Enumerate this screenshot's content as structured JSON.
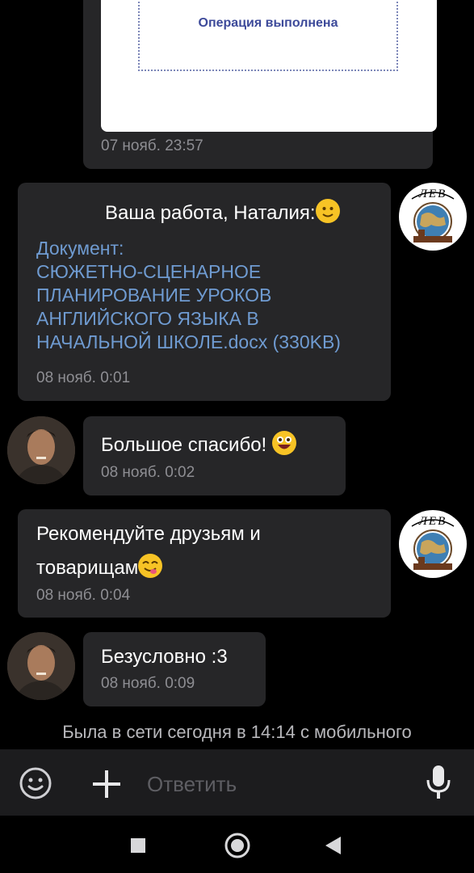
{
  "thread": {
    "receipt_card": {
      "status_text": "Операция выполнена",
      "timestamp": "07 нояб. 23:57"
    },
    "messages": [
      {
        "text": "Ваша работа, Наталия:",
        "emoji": "slight-smile-emoji",
        "attachment": "Документ:\nСЮЖЕТНО-СЦЕНАРНОЕ\nПЛАНИРОВАНИЕ УРОКОВ\nАНГЛИЙСКОГО ЯЗЫКА В\nНАЧАЛЬНОЙ ШКОЛЕ.docx (330KB)",
        "timestamp": "08 нояб. 0:01"
      },
      {
        "text": "Большое спасибо!",
        "emoji": "grinning-emoji",
        "timestamp": "08 нояб. 0:02"
      },
      {
        "text": "Рекомендуйте друзьям и товарищам",
        "line1": "Рекомендуйте друзьям и",
        "line2": "товарищам",
        "emoji": "yum-emoji",
        "timestamp": "08 нояб. 0:04"
      },
      {
        "text": "Безусловно :3",
        "timestamp": "08 нояб. 0:09"
      }
    ],
    "bot_avatar_label": "ЛЕВ",
    "status_line": "Была в сети сегодня в 14:14 с мобильного"
  },
  "composer": {
    "placeholder": "Ответить",
    "icons": [
      "emoji-icon",
      "plus-icon",
      "microphone-icon"
    ]
  },
  "navbar": {
    "icons": [
      "recent-apps-icon",
      "home-icon",
      "back-icon"
    ]
  },
  "colors": {
    "background": "#000000",
    "bubble": "#262628",
    "link": "#6f9bd1",
    "timestamp": "#8e8e93",
    "composer": "#1c1c1e"
  }
}
